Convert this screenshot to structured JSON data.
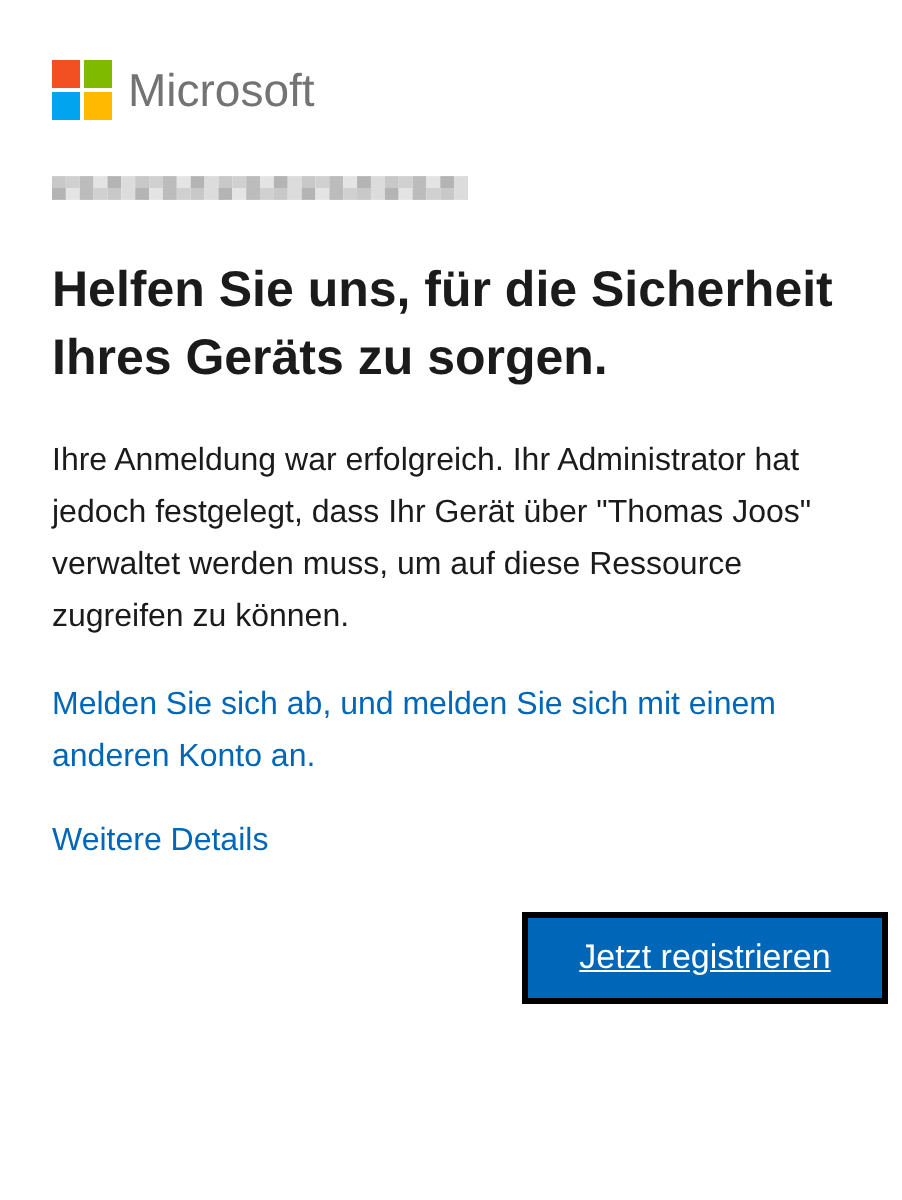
{
  "brand": {
    "name": "Microsoft"
  },
  "heading": "Helfen Sie uns, für die Sicherheit Ihres Geräts zu sorgen.",
  "message": "Ihre Anmeldung war erfolgreich. Ihr Administrator hat jedoch festgelegt, dass Ihr Gerät über \"Thomas Joos\" verwaltet werden muss, um auf diese Ressource zugreifen zu können.",
  "links": [
    "Melden Sie sich ab, und melden Sie sich mit einem anderen Konto an.",
    "Weitere Details"
  ],
  "primary_button": "Jetzt registrieren"
}
